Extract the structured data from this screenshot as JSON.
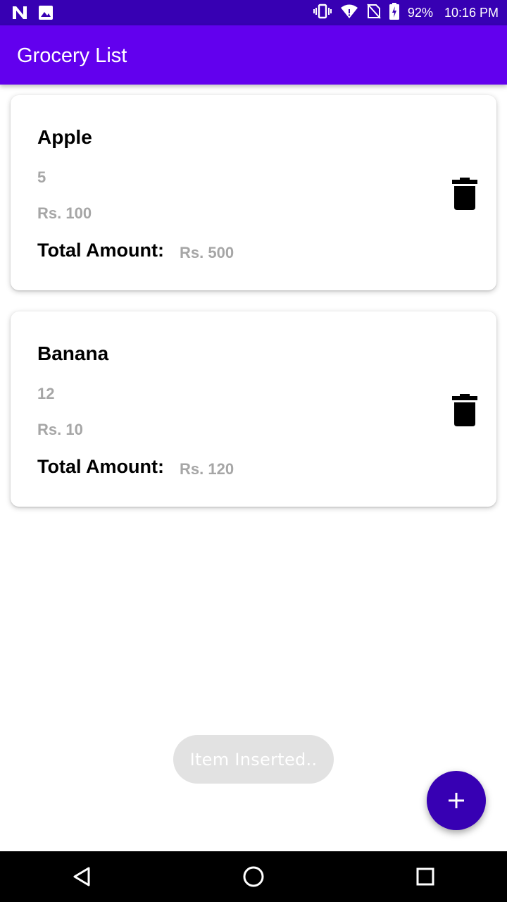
{
  "status_bar": {
    "battery": "92%",
    "time": "10:16 PM",
    "icons_left": [
      "n-logo-icon",
      "image-icon"
    ],
    "icons_right": [
      "vibrate-icon",
      "wifi-icon",
      "no-sim-icon",
      "battery-charging-icon"
    ]
  },
  "app_bar": {
    "title": "Grocery List",
    "color": "#6200EE"
  },
  "items": [
    {
      "name": "Apple",
      "quantity": "5",
      "price": "Rs. 100",
      "total_label": "Total Amount:",
      "total_value": "Rs. 500"
    },
    {
      "name": "Banana",
      "quantity": "12",
      "price": "Rs. 10",
      "total_label": "Total Amount:",
      "total_value": "Rs. 120"
    }
  ],
  "toast": {
    "text": "Item Inserted.."
  },
  "fab": {
    "icon": "plus-icon",
    "color": "#3700B3"
  },
  "nav_bar": {
    "icons": [
      "back-icon",
      "home-icon",
      "recents-icon"
    ]
  }
}
